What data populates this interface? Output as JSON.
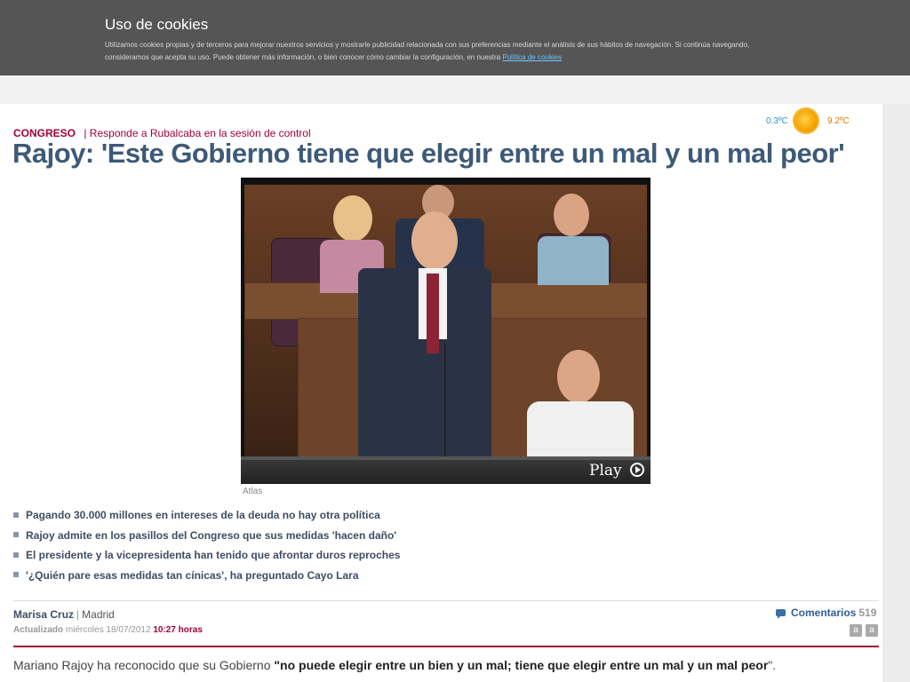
{
  "cookie_banner": {
    "title": "Uso de cookies",
    "text": "Utilizamos cookies propias y de terceros para mejorar nuestros servicios y mostrarle publicidad relacionada con sus preferencias mediante el análisis de sus hábitos de navegación. Si continúa navegando, consideramos que acepta su uso. Puede obtener más información, o bien conocer cómo cambiar la configuración, en nuestra",
    "link_label": "Política de cookies"
  },
  "weather": {
    "min": "0.3ºC",
    "max": "9.2ºC",
    "icon": "sun-icon"
  },
  "article": {
    "section": "CONGRESO",
    "section_sub": "| Responde a Rubalcaba en la sesión de control",
    "headline": "Rajoy: 'Este Gobierno tiene que elegir entre un mal y un mal peor'",
    "video": {
      "play_label": "Play",
      "caption": "Atlas"
    },
    "related": [
      "Pagando 30.000 millones en intereses de la deuda no hay otra política",
      "Rajoy admite en los pasillos del Congreso que sus medidas 'hacen daño'",
      "El presidente y la vicepresidenta han tenido que afrontar duros reproches",
      "'¿Quién pare esas medidas tan cínicas', ha preguntado Cayo Lara"
    ],
    "author": "Marisa Cruz",
    "location": "Madrid",
    "updated_label": "Actualizado",
    "updated_date": "miércoles 18/07/2012",
    "updated_time": "10:27 horas",
    "comments_label": "Comentarios",
    "comments_count": "519",
    "font_smaller": "a",
    "font_larger": "a",
    "body_intro": "Mariano Rajoy ha reconocido que su Gobierno ",
    "body_quote": "\"no puede elegir entre un bien y un mal; tiene que elegir entre un mal y un mal peor",
    "body_end": "\"."
  },
  "colors": {
    "accent": "#a0003a",
    "headline": "#3d5a78",
    "banner": "#555555"
  }
}
